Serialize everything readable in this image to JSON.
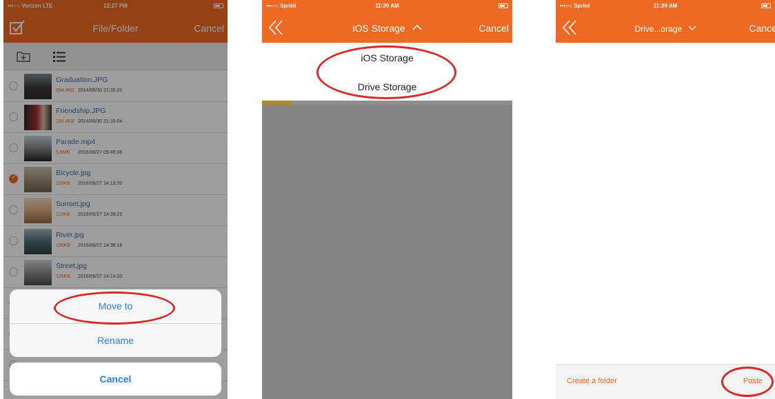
{
  "colors": {
    "accent": "#ee6a22",
    "ios_blue": "#2f7cf6",
    "annotation_red": "#d62a2a"
  },
  "screen1": {
    "status": {
      "carrier": "•••○○ Verizon LTE",
      "time": "12:27 PM"
    },
    "nav": {
      "title": "File/Folder",
      "right": "Cancel",
      "left_icon": "checkbox-icon"
    },
    "toolbar": {
      "icons": [
        "new-folder-icon",
        "list-view-icon"
      ]
    },
    "files": [
      {
        "name": "Graduation.JPG",
        "size": "354.9KB",
        "date": "2014/06/30 21:35:20",
        "selected": false
      },
      {
        "name": "Friendship.JPG",
        "size": "196.8KB",
        "date": "2014/06/30 21:33:04",
        "selected": false
      },
      {
        "name": "Parade.mp4",
        "size": "5.8MB",
        "date": "2016/06/27 09:45:06",
        "selected": false
      },
      {
        "name": "Bicycle.jpg",
        "size": "126KB",
        "date": "2016/06/27 14:13:20",
        "selected": true
      },
      {
        "name": "Sunset.jpg",
        "size": "110KB",
        "date": "2016/06/27 14:39:23",
        "selected": false
      },
      {
        "name": "River.jpg",
        "size": "130KB",
        "date": "2016/06/27 14:38:18",
        "selected": false
      },
      {
        "name": "Street.jpg",
        "size": "126KB",
        "date": "2016/06/27 14:14:33",
        "selected": false
      }
    ],
    "action_sheet": {
      "move_to": "Move to",
      "rename": "Rename",
      "cancel": "Cancel"
    }
  },
  "screen2": {
    "status": {
      "carrier": "•••○○ Sprint",
      "time": "11:39 AM"
    },
    "nav": {
      "title": "iOS Storage",
      "right": "Cancel",
      "left_icon": "double-chevron-left-icon"
    },
    "dropdown": {
      "items": [
        "iOS Storage",
        "Drive Storage"
      ]
    },
    "progress": 0.12
  },
  "screen3": {
    "status": {
      "carrier": "•••○○ Sprint",
      "time": "11:39 AM"
    },
    "nav": {
      "title": "Drive...orage",
      "right": "Cancel",
      "left_icon": "double-chevron-left-icon"
    },
    "bottom": {
      "create_folder": "Create a folder",
      "paste": "Paste"
    }
  }
}
